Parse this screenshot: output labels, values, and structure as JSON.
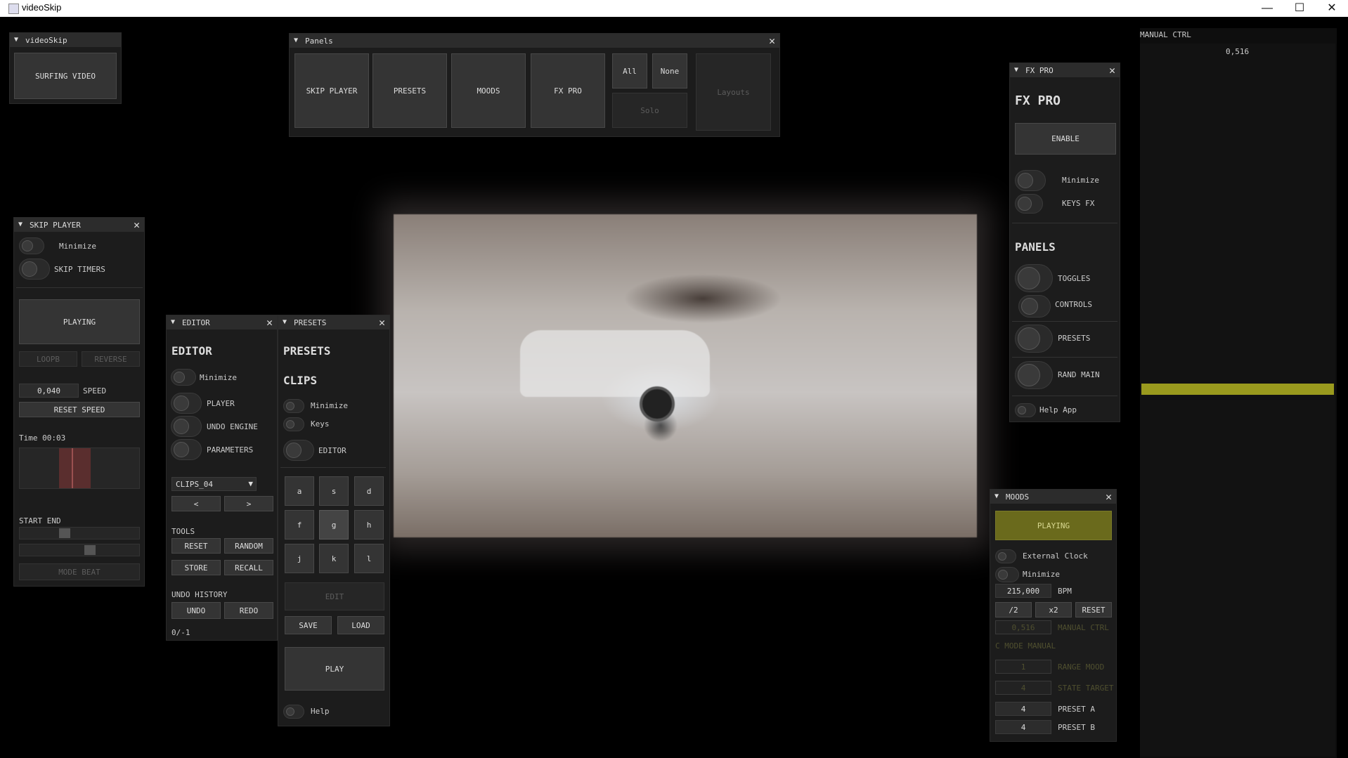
{
  "window": {
    "title": "videoSkip",
    "minimize_glyph": "—",
    "maximize_glyph": "☐",
    "close_glyph": "✕"
  },
  "videoskip_panel": {
    "title": "videoSkip",
    "button": "SURFING VIDEO"
  },
  "panels_panel": {
    "title": "Panels",
    "buttons": [
      "SKIP PLAYER",
      "PRESETS",
      "MOODS",
      "FX PRO"
    ],
    "all": "All",
    "none": "None",
    "solo": "Solo",
    "layouts": "Layouts"
  },
  "manual_ctrl": {
    "title": "MANUAL CTRL",
    "value": "0,516",
    "bar_color": "#9a9a1e",
    "level": 0.516
  },
  "fx_pro": {
    "title": "FX PRO",
    "heading": "FX PRO",
    "enable": "ENABLE",
    "minimize": "Minimize",
    "keys_fx": "KEYS FX",
    "panels_heading": "PANELS",
    "toggles": "TOGGLES",
    "controls": "CONTROLS",
    "presets": "PRESETS",
    "rand_main": "RAND MAIN",
    "help_app": "Help App"
  },
  "skip_player": {
    "title": "SKIP PLAYER",
    "minimize": "Minimize",
    "skip_timers": "SKIP TIMERS",
    "playing": "PLAYING",
    "loopb": "LOOPB",
    "reverse": "REVERSE",
    "speed_value": "0,040",
    "speed_label": "SPEED",
    "reset_speed": "RESET SPEED",
    "time": "Time 00:03",
    "start_end": "START END",
    "mode_beat": "MODE BEAT"
  },
  "editor": {
    "title": "EDITOR",
    "heading": "EDITOR",
    "minimize": "Minimize",
    "player": "PLAYER",
    "undo_engine": "UNDO ENGINE",
    "parameters": "PARAMETERS",
    "clip_select": "CLIPS_04",
    "prev": "<",
    "next": ">",
    "tools": "TOOLS",
    "reset": "RESET",
    "random": "RANDOM",
    "store": "STORE",
    "recall": "RECALL",
    "undo_history": "UNDO HISTORY",
    "undo": "UNDO",
    "redo": "REDO",
    "counter": "0/-1"
  },
  "presets": {
    "title": "PRESETS",
    "heading": "PRESETS",
    "clips": "CLIPS",
    "minimize": "Minimize",
    "keys": "Keys",
    "editor": "EDITOR",
    "keys_grid": [
      "a",
      "s",
      "d",
      "f",
      "g",
      "h",
      "j",
      "k",
      "l"
    ],
    "edit": "EDIT",
    "save": "SAVE",
    "load": "LOAD",
    "play": "PLAY",
    "help": "Help"
  },
  "moods": {
    "title": "MOODS",
    "playing": "PLAYING",
    "external_clock": "External Clock",
    "minimize": "Minimize",
    "bpm_value": "215,000",
    "bpm_label": "BPM",
    "half": "/2",
    "double": "x2",
    "reset": "RESET",
    "manual_value": "0,516",
    "manual_label": "MANUAL CTRL",
    "c_mode": "C MODE MANUAL",
    "range_value": "1",
    "range_label": "RANGE MOOD",
    "state_value": "4",
    "state_label": "STATE TARGET",
    "preset_a_value": "4",
    "preset_a_label": "PRESET A",
    "preset_b_value": "4",
    "preset_b_label": "PRESET B",
    "accent": "#7a7a1e"
  }
}
